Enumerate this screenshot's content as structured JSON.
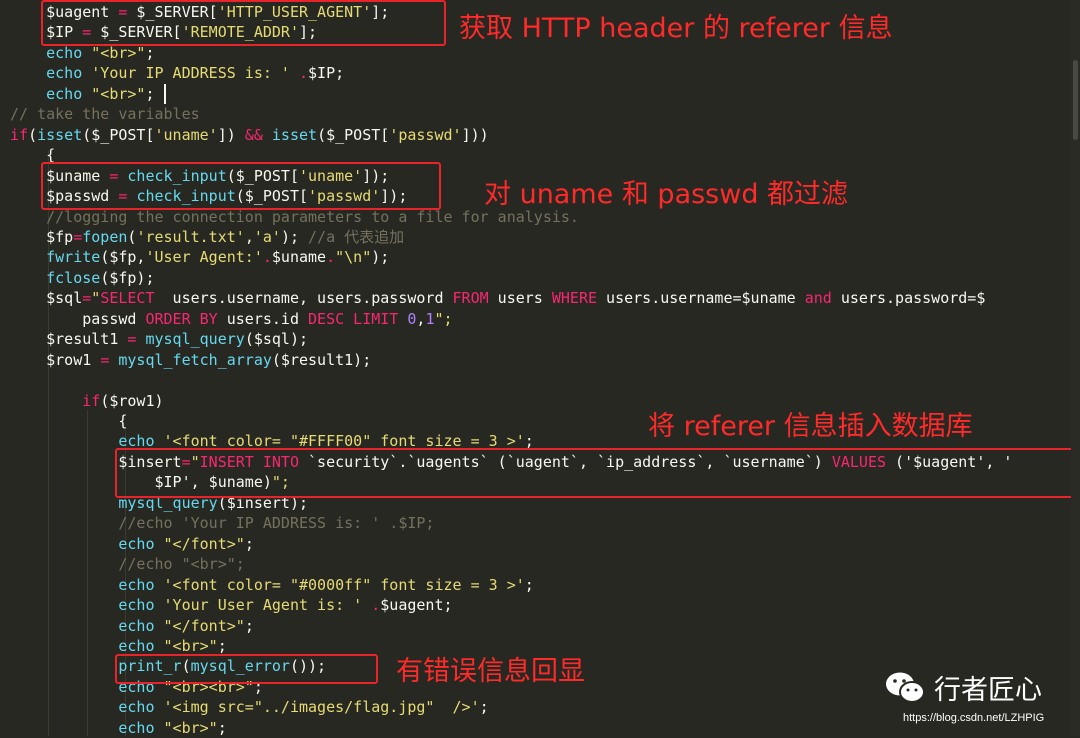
{
  "code_lines": [
    {
      "tokens": [
        {
          "t": "    ",
          "c": "w"
        },
        {
          "t": "$uagent ",
          "c": "w"
        },
        {
          "t": "=",
          "c": "p"
        },
        {
          "t": " $_SERVER[",
          "c": "w"
        },
        {
          "t": "'HTTP_USER_AGENT'",
          "c": "s"
        },
        {
          "t": "];",
          "c": "w"
        }
      ]
    },
    {
      "tokens": [
        {
          "t": "    ",
          "c": "w"
        },
        {
          "t": "$IP ",
          "c": "w"
        },
        {
          "t": "=",
          "c": "p"
        },
        {
          "t": " $_SERVER[",
          "c": "w"
        },
        {
          "t": "'REMOTE_ADDR'",
          "c": "s"
        },
        {
          "t": "];",
          "c": "w"
        }
      ]
    },
    {
      "tokens": [
        {
          "t": "    ",
          "c": "w"
        },
        {
          "t": "echo",
          "c": "k"
        },
        {
          "t": " ",
          "c": "w"
        },
        {
          "t": "\"<br>\"",
          "c": "s"
        },
        {
          "t": ";",
          "c": "w"
        }
      ]
    },
    {
      "tokens": [
        {
          "t": "    ",
          "c": "w"
        },
        {
          "t": "echo",
          "c": "k"
        },
        {
          "t": " ",
          "c": "w"
        },
        {
          "t": "'Your IP ADDRESS is: '",
          "c": "s"
        },
        {
          "t": " ",
          "c": "w"
        },
        {
          "t": ".",
          "c": "p"
        },
        {
          "t": "$IP;",
          "c": "w"
        }
      ]
    },
    {
      "tokens": [
        {
          "t": "    ",
          "c": "w"
        },
        {
          "t": "echo",
          "c": "k"
        },
        {
          "t": " ",
          "c": "w"
        },
        {
          "t": "\"<br>\"",
          "c": "s"
        },
        {
          "t": ";",
          "c": "w"
        }
      ]
    },
    {
      "tokens": [
        {
          "t": "// take the variables",
          "c": "c"
        }
      ]
    },
    {
      "tokens": [
        {
          "t": "if",
          "c": "p"
        },
        {
          "t": "(",
          "c": "w"
        },
        {
          "t": "isset",
          "c": "k"
        },
        {
          "t": "($_POST[",
          "c": "w"
        },
        {
          "t": "'uname'",
          "c": "s"
        },
        {
          "t": "]) ",
          "c": "w"
        },
        {
          "t": "&&",
          "c": "p"
        },
        {
          "t": " ",
          "c": "w"
        },
        {
          "t": "isset",
          "c": "k"
        },
        {
          "t": "($_POST[",
          "c": "w"
        },
        {
          "t": "'passwd'",
          "c": "s"
        },
        {
          "t": "]))",
          "c": "w"
        }
      ]
    },
    {
      "tokens": [
        {
          "t": "    {",
          "c": "w"
        }
      ]
    },
    {
      "tokens": [
        {
          "t": "    ",
          "c": "w"
        },
        {
          "t": "$uname ",
          "c": "w"
        },
        {
          "t": "=",
          "c": "p"
        },
        {
          "t": " ",
          "c": "w"
        },
        {
          "t": "check_input",
          "c": "k"
        },
        {
          "t": "($_POST[",
          "c": "w"
        },
        {
          "t": "'uname'",
          "c": "s"
        },
        {
          "t": "]);",
          "c": "w"
        }
      ]
    },
    {
      "tokens": [
        {
          "t": "    ",
          "c": "w"
        },
        {
          "t": "$passwd ",
          "c": "w"
        },
        {
          "t": "=",
          "c": "p"
        },
        {
          "t": " ",
          "c": "w"
        },
        {
          "t": "check_input",
          "c": "k"
        },
        {
          "t": "($_POST[",
          "c": "w"
        },
        {
          "t": "'passwd'",
          "c": "s"
        },
        {
          "t": "]);",
          "c": "w"
        }
      ]
    },
    {
      "tokens": [
        {
          "t": "    ",
          "c": "w"
        },
        {
          "t": "//logging the connection parameters to a file for analysis.",
          "c": "c"
        }
      ]
    },
    {
      "tokens": [
        {
          "t": "    ",
          "c": "w"
        },
        {
          "t": "$fp",
          "c": "w"
        },
        {
          "t": "=",
          "c": "p"
        },
        {
          "t": "fopen",
          "c": "k"
        },
        {
          "t": "(",
          "c": "w"
        },
        {
          "t": "'result.txt'",
          "c": "s"
        },
        {
          "t": ",",
          "c": "w"
        },
        {
          "t": "'a'",
          "c": "s"
        },
        {
          "t": "); ",
          "c": "w"
        },
        {
          "t": "//a 代表追加",
          "c": "c"
        }
      ]
    },
    {
      "tokens": [
        {
          "t": "    ",
          "c": "w"
        },
        {
          "t": "fwrite",
          "c": "k"
        },
        {
          "t": "($fp,",
          "c": "w"
        },
        {
          "t": "'User Agent:'",
          "c": "s"
        },
        {
          "t": ".",
          "c": "p"
        },
        {
          "t": "$uname",
          "c": "w"
        },
        {
          "t": ".",
          "c": "p"
        },
        {
          "t": "\"\\n\"",
          "c": "s"
        },
        {
          "t": ");",
          "c": "w"
        }
      ]
    },
    {
      "tokens": [
        {
          "t": "    ",
          "c": "w"
        },
        {
          "t": "fclose",
          "c": "k"
        },
        {
          "t": "($fp);",
          "c": "w"
        }
      ]
    },
    {
      "tokens": [
        {
          "t": "    ",
          "c": "w"
        },
        {
          "t": "$sql",
          "c": "w"
        },
        {
          "t": "=",
          "c": "p"
        },
        {
          "t": "\"",
          "c": "s"
        },
        {
          "t": "SELECT",
          "c": "p"
        },
        {
          "t": "  users.username, users.password ",
          "c": "w"
        },
        {
          "t": "FROM",
          "c": "p"
        },
        {
          "t": " users ",
          "c": "w"
        },
        {
          "t": "WHERE",
          "c": "p"
        },
        {
          "t": " users.username=$uname ",
          "c": "w"
        },
        {
          "t": "and",
          "c": "p"
        },
        {
          "t": " users.password=$",
          "c": "w"
        }
      ]
    },
    {
      "tokens": [
        {
          "t": "        ",
          "c": "w"
        },
        {
          "t": "passwd ",
          "c": "w"
        },
        {
          "t": "ORDER BY",
          "c": "p"
        },
        {
          "t": " users.id ",
          "c": "w"
        },
        {
          "t": "DESC LIMIT",
          "c": "p"
        },
        {
          "t": " ",
          "c": "w"
        },
        {
          "t": "0",
          "c": "n"
        },
        {
          "t": ",",
          "c": "w"
        },
        {
          "t": "1",
          "c": "n"
        },
        {
          "t": "\";",
          "c": "s"
        }
      ]
    },
    {
      "tokens": [
        {
          "t": "    ",
          "c": "w"
        },
        {
          "t": "$result1 ",
          "c": "w"
        },
        {
          "t": "=",
          "c": "p"
        },
        {
          "t": " ",
          "c": "w"
        },
        {
          "t": "mysql_query",
          "c": "k"
        },
        {
          "t": "($sql);",
          "c": "w"
        }
      ]
    },
    {
      "tokens": [
        {
          "t": "    ",
          "c": "w"
        },
        {
          "t": "$row1 ",
          "c": "w"
        },
        {
          "t": "=",
          "c": "p"
        },
        {
          "t": " ",
          "c": "w"
        },
        {
          "t": "mysql_fetch_array",
          "c": "k"
        },
        {
          "t": "($result1);",
          "c": "w"
        }
      ]
    },
    {
      "tokens": []
    },
    {
      "tokens": [
        {
          "t": "        ",
          "c": "w"
        },
        {
          "t": "if",
          "c": "p"
        },
        {
          "t": "($row1)",
          "c": "w"
        }
      ]
    },
    {
      "tokens": [
        {
          "t": "            {",
          "c": "w"
        }
      ]
    },
    {
      "tokens": [
        {
          "t": "            ",
          "c": "w"
        },
        {
          "t": "echo",
          "c": "k"
        },
        {
          "t": " ",
          "c": "w"
        },
        {
          "t": "'<font color= \"#FFFF00\" font size = 3 >'",
          "c": "s"
        },
        {
          "t": ";",
          "c": "w"
        }
      ]
    },
    {
      "tokens": [
        {
          "t": "            ",
          "c": "w"
        },
        {
          "t": "$insert",
          "c": "w"
        },
        {
          "t": "=",
          "c": "p"
        },
        {
          "t": "\"",
          "c": "s"
        },
        {
          "t": "INSERT INTO",
          "c": "p"
        },
        {
          "t": " `security`.`uagents` (`uagent`, `ip_address`, `username`) ",
          "c": "w"
        },
        {
          "t": "VALUES",
          "c": "p"
        },
        {
          "t": " ('$uagent', '",
          "c": "w"
        }
      ]
    },
    {
      "tokens": [
        {
          "t": "                ",
          "c": "w"
        },
        {
          "t": "$IP', $uname)",
          "c": "w"
        },
        {
          "t": "\";",
          "c": "s"
        }
      ]
    },
    {
      "tokens": [
        {
          "t": "            ",
          "c": "w"
        },
        {
          "t": "mysql_query",
          "c": "k"
        },
        {
          "t": "($insert);",
          "c": "w"
        }
      ]
    },
    {
      "tokens": [
        {
          "t": "            ",
          "c": "w"
        },
        {
          "t": "//echo 'Your IP ADDRESS is: ' .$IP;",
          "c": "c"
        }
      ]
    },
    {
      "tokens": [
        {
          "t": "            ",
          "c": "w"
        },
        {
          "t": "echo",
          "c": "k"
        },
        {
          "t": " ",
          "c": "w"
        },
        {
          "t": "\"</font>\"",
          "c": "s"
        },
        {
          "t": ";",
          "c": "w"
        }
      ]
    },
    {
      "tokens": [
        {
          "t": "            ",
          "c": "w"
        },
        {
          "t": "//echo \"<br>\";",
          "c": "c"
        }
      ]
    },
    {
      "tokens": [
        {
          "t": "            ",
          "c": "w"
        },
        {
          "t": "echo",
          "c": "k"
        },
        {
          "t": " ",
          "c": "w"
        },
        {
          "t": "'<font color= \"#0000ff\" font size = 3 >'",
          "c": "s"
        },
        {
          "t": ";",
          "c": "w"
        }
      ]
    },
    {
      "tokens": [
        {
          "t": "            ",
          "c": "w"
        },
        {
          "t": "echo",
          "c": "k"
        },
        {
          "t": " ",
          "c": "w"
        },
        {
          "t": "'Your User Agent is: '",
          "c": "s"
        },
        {
          "t": " ",
          "c": "w"
        },
        {
          "t": ".",
          "c": "p"
        },
        {
          "t": "$uagent;",
          "c": "w"
        }
      ]
    },
    {
      "tokens": [
        {
          "t": "            ",
          "c": "w"
        },
        {
          "t": "echo",
          "c": "k"
        },
        {
          "t": " ",
          "c": "w"
        },
        {
          "t": "\"</font>\"",
          "c": "s"
        },
        {
          "t": ";",
          "c": "w"
        }
      ]
    },
    {
      "tokens": [
        {
          "t": "            ",
          "c": "w"
        },
        {
          "t": "echo",
          "c": "k"
        },
        {
          "t": " ",
          "c": "w"
        },
        {
          "t": "\"<br>\"",
          "c": "s"
        },
        {
          "t": ";",
          "c": "w"
        }
      ]
    },
    {
      "tokens": [
        {
          "t": "            ",
          "c": "w"
        },
        {
          "t": "print_r",
          "c": "k"
        },
        {
          "t": "(",
          "c": "w"
        },
        {
          "t": "mysql_error",
          "c": "k"
        },
        {
          "t": "());",
          "c": "w"
        }
      ]
    },
    {
      "tokens": [
        {
          "t": "            ",
          "c": "w"
        },
        {
          "t": "echo",
          "c": "k"
        },
        {
          "t": " ",
          "c": "w"
        },
        {
          "t": "\"<br><br>\"",
          "c": "s"
        },
        {
          "t": ";",
          "c": "w"
        }
      ]
    },
    {
      "tokens": [
        {
          "t": "            ",
          "c": "w"
        },
        {
          "t": "echo",
          "c": "k"
        },
        {
          "t": " ",
          "c": "w"
        },
        {
          "t": "'<img src=\"../images/flag.jpg\"  />'",
          "c": "s"
        },
        {
          "t": ";",
          "c": "w"
        }
      ]
    },
    {
      "tokens": [
        {
          "t": "            ",
          "c": "w"
        },
        {
          "t": "echo",
          "c": "k"
        },
        {
          "t": " ",
          "c": "w"
        },
        {
          "t": "\"<br>\"",
          "c": "s"
        },
        {
          "t": ";",
          "c": "w"
        }
      ]
    }
  ],
  "annotations": {
    "referer": "获取 HTTP header 的 referer 信息",
    "filter": "对 uname 和 passwd 都过滤",
    "insert": "将 referer 信息插入数据库",
    "error": "有错误信息回显"
  },
  "watermark": {
    "name": "行者匠心",
    "icon": "wechat-icon",
    "url": "https://blog.csdn.net/LZHPIG"
  },
  "colors": {
    "background": "#272822",
    "annotation_red": "#e8232a",
    "keyword_blue": "#66d9ef",
    "operator_pink": "#f92672",
    "string_yellow": "#e6db74",
    "comment_gray": "#75715e"
  }
}
